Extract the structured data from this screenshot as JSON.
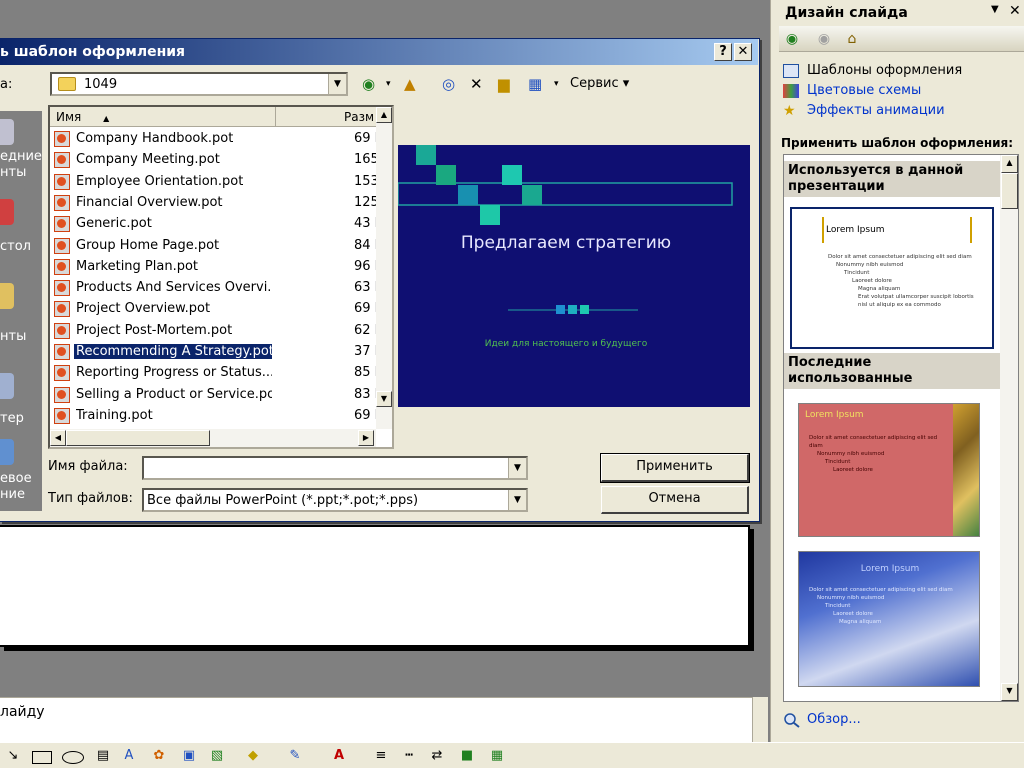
{
  "dialog": {
    "title": "ь шаблон оформления",
    "help_btn": "?",
    "close_btn": "✕",
    "lookin_label": "а:",
    "lookin_value": "1049",
    "tools_menu": "Сервис ▾",
    "columns": {
      "name": "Имя",
      "size": "Разм"
    },
    "files": [
      {
        "name": "Company Handbook.pot",
        "size": "69 I"
      },
      {
        "name": "Company Meeting.pot",
        "size": "165 I"
      },
      {
        "name": "Employee Orientation.pot",
        "size": "153 I"
      },
      {
        "name": "Financial Overview.pot",
        "size": "125 I"
      },
      {
        "name": "Generic.pot",
        "size": "43 I"
      },
      {
        "name": "Group Home Page.pot",
        "size": "84 I"
      },
      {
        "name": "Marketing Plan.pot",
        "size": "96 I"
      },
      {
        "name": "Products And Services Overvi...",
        "size": "63 I"
      },
      {
        "name": "Project Overview.pot",
        "size": "69 I"
      },
      {
        "name": "Project Post-Mortem.pot",
        "size": "62 I"
      },
      {
        "name": "Recommending A Strategy.pot",
        "size": "37 I"
      },
      {
        "name": "Reporting Progress or Status....",
        "size": "85 I"
      },
      {
        "name": "Selling a Product or Service.pot",
        "size": "83 I"
      },
      {
        "name": "Training.pot",
        "size": "69 I"
      }
    ],
    "selected_index": 10,
    "places": [
      "едние",
      "нты",
      "стол",
      "нты",
      "тер",
      "евое",
      "ние"
    ],
    "preview": {
      "title": "Предлагаем стратегию",
      "subtitle": "Идеи для настоящего и будущего",
      "bg_color": "#0f0f72",
      "accent_color": "#1ec8b0"
    },
    "filename_label": "Имя файла:",
    "filename_value": "",
    "filetype_label": "Тип файлов:",
    "filetype_value": "Все файлы PowerPoint (*.ppt;*.pot;*.pps)",
    "apply_label": "Применить",
    "cancel_label": "Отмена"
  },
  "task_pane": {
    "title": "Дизайн слайда",
    "links": [
      "Шаблоны оформления",
      "Цветовые схемы",
      "Эффекты анимации"
    ],
    "apply_label": "Применить шаблон оформления:",
    "section_current": "Используется в данной презентации",
    "section_recent": "Последние использованные",
    "thumb_title": "Lorem Ipsum",
    "thumb_bullets": [
      "Dolor sit amet consectetuer adipiscing elit sed diam",
      "Nonummy nibh euismod",
      "Tincidunt",
      "Laoreet dolore",
      "Magna aliquam",
      "Erat volutpat ullamcorper suscipit lobortis nisl ut aliquip ex ea commodo"
    ],
    "browse_label": "Обзор..."
  },
  "notes": {
    "text": "лайду"
  },
  "toolbar_icons": [
    "arrow-icon",
    "rectangle-icon",
    "oval-icon",
    "textbox-icon",
    "diagram-icon",
    "clipart-icon",
    "picture-icon",
    "fill-color-icon",
    "line-color-icon",
    "font-color-icon",
    "line-style-icon",
    "dash-style-icon",
    "arrow-style-icon",
    "shadow-icon",
    "3d-icon"
  ]
}
